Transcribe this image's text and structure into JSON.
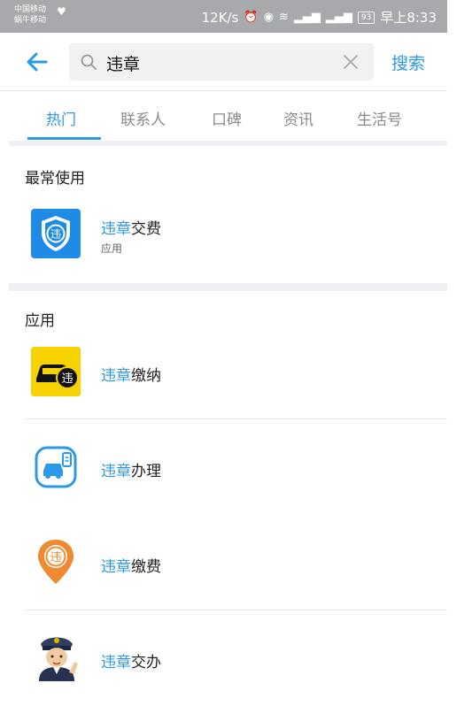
{
  "status_bar": {
    "carrier_1": "中国移动",
    "carrier_2": "蜗牛移动",
    "speed": "12K/s",
    "battery": "93",
    "time": "早上8:33"
  },
  "search": {
    "query": "违章",
    "action_label": "搜索"
  },
  "tabs": [
    "热门",
    "联系人",
    "口碑",
    "资讯",
    "生活号"
  ],
  "frequent": {
    "title": "最常使用",
    "items": [
      {
        "highlight": "违章",
        "rest": "交费",
        "subtitle": "应用",
        "icon": "shield-violation-icon"
      }
    ]
  },
  "apps": {
    "title": "应用",
    "items": [
      {
        "highlight": "违章",
        "rest": "缴纳",
        "icon": "car-violation-icon"
      },
      {
        "highlight": "违章",
        "rest": "办理",
        "icon": "car-document-icon"
      },
      {
        "highlight": "违章",
        "rest": "缴费",
        "icon": "location-pin-violation-icon"
      },
      {
        "highlight": "违章",
        "rest": "交办",
        "icon": "traffic-police-icon"
      }
    ]
  },
  "colors": {
    "accent": "#2a9ae8",
    "status_bar": "#a7a9ac",
    "section_bg": "#eef0f3"
  }
}
